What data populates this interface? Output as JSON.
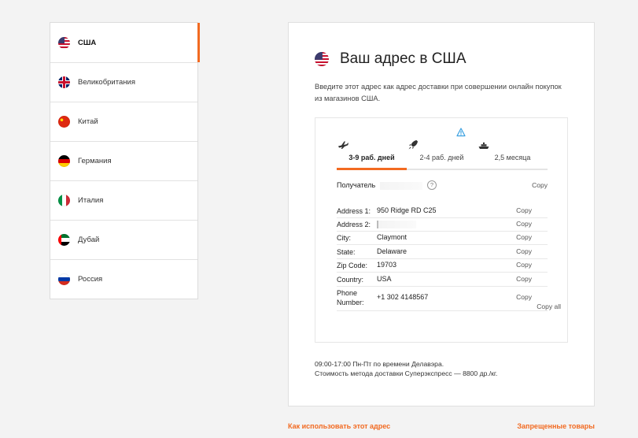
{
  "countries": [
    {
      "label": "США",
      "flag": "us",
      "active": true
    },
    {
      "label": "Великобритания",
      "flag": "gb",
      "active": false
    },
    {
      "label": "Китай",
      "flag": "cn",
      "active": false
    },
    {
      "label": "Германия",
      "flag": "de",
      "active": false
    },
    {
      "label": "Италия",
      "flag": "it",
      "active": false
    },
    {
      "label": "Дубай",
      "flag": "ae",
      "active": false
    },
    {
      "label": "Россия",
      "flag": "ru",
      "active": false
    }
  ],
  "panel": {
    "title": "Ваш адрес в США",
    "description": "Введите этот адрес как адрес доставки при совершении онлайн покупок из магазинов США.",
    "flag": "us"
  },
  "tabs": [
    {
      "label": "3-9 раб. дней",
      "icon": "plane-icon",
      "active": true
    },
    {
      "label": "2-4 раб. дней",
      "icon": "rocket-icon",
      "active": false,
      "warning": true
    },
    {
      "label": "2,5 месяца",
      "icon": "ship-icon",
      "active": false
    }
  ],
  "recipient": {
    "label": "Получатель",
    "value": "",
    "copy": "Copy"
  },
  "address_rows": [
    {
      "label": "Address 1:",
      "value": "950 Ridge RD C25",
      "copy": "Copy"
    },
    {
      "label": "Address 2:",
      "value": "",
      "copy": "Copy"
    },
    {
      "label": "City:",
      "value": "Claymont",
      "copy": "Copy"
    },
    {
      "label": "State:",
      "value": "Delaware",
      "copy": "Copy"
    },
    {
      "label": "Zip Code:",
      "value": "19703",
      "copy": "Copy"
    },
    {
      "label": "Country:",
      "value": "USA",
      "copy": "Copy"
    },
    {
      "label": "Phone Number:",
      "value": "+1 302 4148567",
      "copy": "Copy"
    }
  ],
  "copy_all": "Copy all",
  "footer": {
    "hours": "09:00-17:00 Пн-Пт по времени Делавэра.",
    "cost": "Стоимость метода доставки Суперэкспресс — 8800 др./кг."
  },
  "links": {
    "how_to": "Как использовать этот адрес",
    "prohibited": "Запрещенные товары"
  },
  "colors": {
    "accent": "#f26a21",
    "background": "#f3f3f3"
  }
}
